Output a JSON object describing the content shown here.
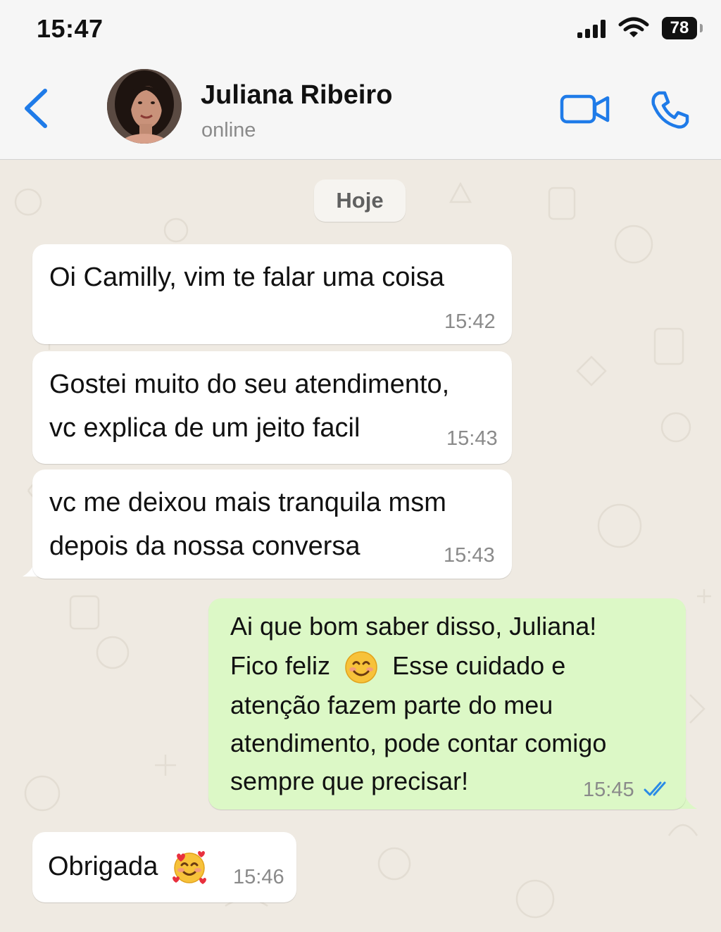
{
  "status_bar": {
    "time": "15:47",
    "battery": "78"
  },
  "header": {
    "contact_name": "Juliana Ribeiro",
    "contact_status": "online"
  },
  "chat": {
    "date_label": "Hoje",
    "messages": [
      {
        "direction": "incoming",
        "lines": [
          "Oi Camilly, vim te falar uma coisa"
        ],
        "time": "15:42"
      },
      {
        "direction": "incoming",
        "lines": [
          "Gostei muito do seu atendimento,",
          "vc explica de um jeito facil"
        ],
        "time": "15:43"
      },
      {
        "direction": "incoming",
        "lines": [
          "vc me deixou mais tranquila msm",
          "depois da nossa conversa"
        ],
        "time": "15:43"
      },
      {
        "direction": "outgoing",
        "lines": [
          "Ai que bom saber disso, Juliana!",
          "Fico feliz",
          "Esse cuidado e",
          "atenção fazem parte do meu",
          "atendimento, pode contar comigo",
          "sempre que precisar!"
        ],
        "emoji": "smiling-face-with-smiling-eyes",
        "time": "15:45",
        "read": true
      },
      {
        "direction": "incoming",
        "lines": [
          "Obrigada"
        ],
        "emoji": "smiling-face-with-hearts",
        "time": "15:46"
      }
    ]
  },
  "colors": {
    "accent": "#1f7be8",
    "incoming_bubble": "#ffffff",
    "outgoing_bubble": "#dcf8c6",
    "chat_background": "#efeae2",
    "read_ticks": "#2a8be6"
  }
}
